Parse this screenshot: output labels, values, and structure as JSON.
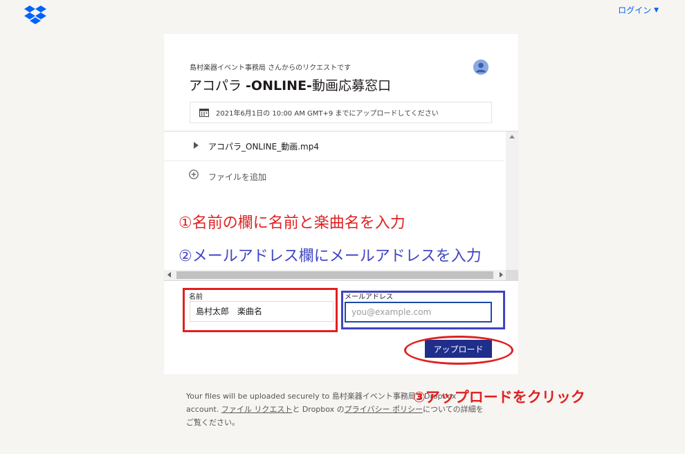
{
  "header": {
    "login_label": "ログイン"
  },
  "request": {
    "from_text": "島村楽器イベント事務局 さんからのリクエストです",
    "title_prefix": "アコパラ ",
    "title_bold": "-ONLINE-",
    "title_suffix": "動画応募窓口",
    "deadline_text": "2021年6月1日の 10:00 AM GMT+9 までにアップロードしてください"
  },
  "files": {
    "items": [
      {
        "name": "アコパラ_ONLINE_動画.mp4"
      }
    ],
    "add_label": "ファイルを追加"
  },
  "form": {
    "name_label": "名前",
    "name_value": "島村太郎　楽曲名",
    "email_label": "メールアドレス",
    "email_placeholder": "you@example.com",
    "upload_label": "アップロード"
  },
  "annotations": {
    "step1": "①名前の欄に名前と楽曲名を入力",
    "step2": "②メールアドレス欄にメールアドレスを入力",
    "step3": "③アップロードをクリック"
  },
  "footer": {
    "line_start": "Your files will be uploaded securely to 島村楽器イベント事務局's Dropbox account. ",
    "link_requests": "ファイル リクエスト",
    "middle": "と Dropbox の",
    "link_privacy": "プライバシー ポリシー",
    "end": "についての詳細をご覧ください。"
  },
  "colors": {
    "brand_blue": "#0061fe",
    "upload_button": "#1f2e8a",
    "annotation_red": "#e02020",
    "annotation_blue": "#3f44c4"
  },
  "icons": [
    "dropbox-logo-icon",
    "caret-down-icon",
    "avatar-icon",
    "calendar-icon",
    "play-icon",
    "plus-circle-icon"
  ]
}
